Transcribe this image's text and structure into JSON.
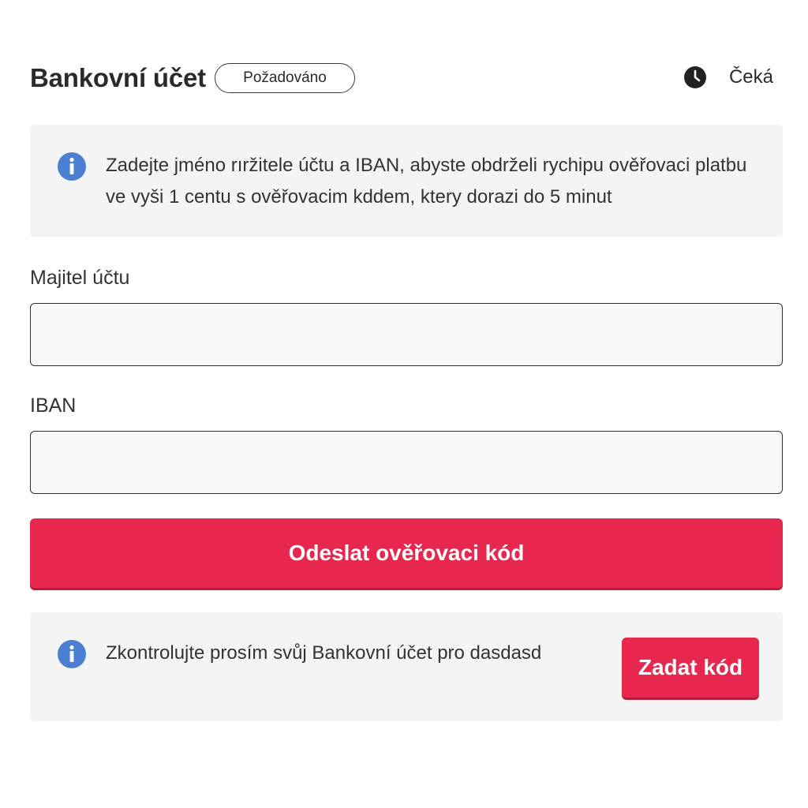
{
  "header": {
    "title": "Bankovní účet",
    "badge": "Požadováno",
    "status_icon": "clock-icon",
    "status_text": "Čeká"
  },
  "info_top": {
    "icon": "info-icon",
    "text": "Zadejte jméno rıržitele účtu a IBAN, abyste obdrželi rychipu ověřovaci platbu ve vyši 1 centu s ověřovacim kddem, ktery dorazi do 5 minut"
  },
  "form": {
    "owner_label": "Majitel účtu",
    "owner_value": "",
    "iban_label": "IBAN",
    "iban_value": "",
    "send_button_label": "Odeslat ověřovaci kód"
  },
  "info_bottom": {
    "icon": "info-icon",
    "text": "Zkontrolujte prosím svůj Bankovní účet pro dasdasd",
    "button_label": "Zadat kód"
  },
  "colors": {
    "accent": "#e8274f",
    "info_icon": "#4a7fd1",
    "panel_bg": "#f4f4f4"
  }
}
